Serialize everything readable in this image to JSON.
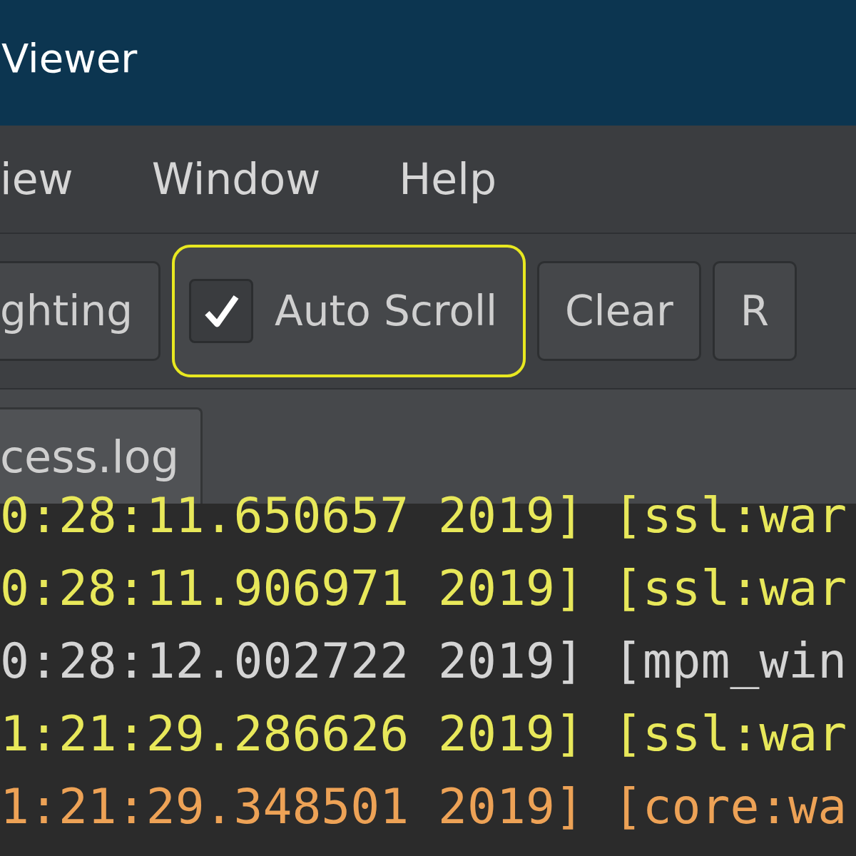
{
  "window": {
    "title": "Viewer"
  },
  "menu": [
    {
      "label": "iew"
    },
    {
      "label": "Window"
    },
    {
      "label": "Help"
    }
  ],
  "toolbar": [
    {
      "kind": "button",
      "label": "ghting",
      "focused": false
    },
    {
      "kind": "checkbox",
      "label": "Auto Scroll",
      "checked": true,
      "focused": true
    },
    {
      "kind": "button",
      "label": "Clear",
      "focused": false
    },
    {
      "kind": "button",
      "label": "R",
      "focused": false
    }
  ],
  "tabs": [
    {
      "label": "cess.log",
      "selected": true
    }
  ],
  "log_lines": [
    {
      "text": "0:28:11.650657 2019] [ssl:war",
      "color": "#e8e85a"
    },
    {
      "text": "0:28:11.906971 2019] [ssl:war",
      "color": "#e8e85a"
    },
    {
      "text": "0:28:12.002722 2019] [mpm_win",
      "color": "#d4d4d4"
    },
    {
      "text": "1:21:29.286626 2019] [ssl:war",
      "color": "#e8e85a"
    },
    {
      "text": "1:21:29.348501 2019] [core:wa",
      "color": "#eda256"
    }
  ]
}
